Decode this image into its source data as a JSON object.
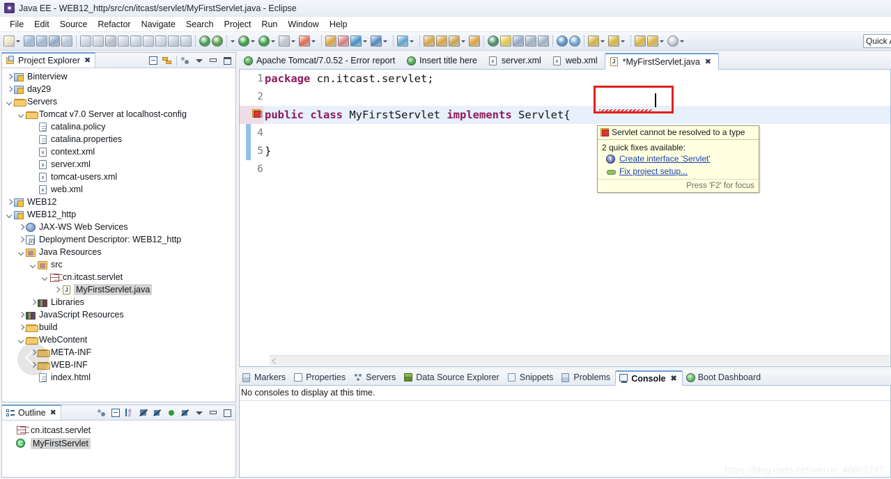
{
  "window": {
    "title": "Java EE - WEB12_http/src/cn/itcast/servlet/MyFirstServlet.java - Eclipse",
    "app_icon": "eclipse-icon"
  },
  "menubar": {
    "items": [
      "File",
      "Edit",
      "Source",
      "Refactor",
      "Navigate",
      "Search",
      "Project",
      "Run",
      "Window",
      "Help"
    ]
  },
  "toolbar": {
    "quick_access_placeholder": "Quick Access",
    "quick_access_value": "Quick A",
    "icons": [
      "new-wizard-icon",
      "new-dropdown-icon",
      "save-icon",
      "save-all-icon",
      "print-icon",
      "quick-fix-icon",
      "resume-icon",
      "suspend-icon",
      "terminate-icon",
      "disconnect-icon",
      "step-into-icon",
      "step-over-icon",
      "step-return-icon",
      "skip-breakpoints-icon",
      "run-last-tool-icon",
      "open-type-icon",
      "debug-icon",
      "debug-dropdown-icon",
      "run-icon",
      "run-dropdown-icon",
      "run-as-icon",
      "run-as-dropdown-icon",
      "stop-icon",
      "stop-dropdown-icon",
      "run-server-icon",
      "run-server-dropdown-icon",
      "new-java-project-icon",
      "new-package-icon",
      "new-class-icon",
      "new-class-dropdown-icon",
      "new-annotation-icon",
      "new-annotation-dropdown-icon",
      "search-icon",
      "search-dropdown-icon",
      "open-resource-icon",
      "open-folder-icon",
      "edit-icon",
      "edit-dropdown-icon",
      "open-perspective-icon",
      "pin-editor-icon",
      "toggle-mark-occurrences-icon",
      "link-icon",
      "show-whitespace-icon",
      "word-wrap-icon",
      "browser-icon",
      "external-tools-icon",
      "download-icon",
      "download-dropdown-icon",
      "upload-icon",
      "upload-dropdown-icon",
      "back-icon",
      "forward-icon",
      "forward-dropdown-icon",
      "next-annotation-icon",
      "next-annotation-dropdown-icon"
    ]
  },
  "project_explorer": {
    "tab_label": "Project Explorer",
    "tab_icon": "project-explorer-icon",
    "close_glyph": "✖",
    "tools": [
      "collapse-all-icon",
      "link-with-editor-icon",
      "view-filter-icon",
      "view-menu-icon",
      "minimize-icon",
      "maximize-icon"
    ],
    "tree": [
      {
        "label": "Binterview",
        "indent": 0,
        "twisty": "closed",
        "icon": "java-project-icon"
      },
      {
        "label": "day29",
        "indent": 0,
        "twisty": "closed",
        "icon": "java-project-icon"
      },
      {
        "label": "Servers",
        "indent": 0,
        "twisty": "open",
        "icon": "folder-open-icon"
      },
      {
        "label": "Tomcat v7.0 Server at localhost-config",
        "indent": 1,
        "twisty": "open",
        "icon": "folder-open-icon"
      },
      {
        "label": "catalina.policy",
        "indent": 2,
        "twisty": "none",
        "icon": "file-icon"
      },
      {
        "label": "catalina.properties",
        "indent": 2,
        "twisty": "none",
        "icon": "file-icon"
      },
      {
        "label": "context.xml",
        "indent": 2,
        "twisty": "none",
        "icon": "xml-file-icon"
      },
      {
        "label": "server.xml",
        "indent": 2,
        "twisty": "none",
        "icon": "xml-file-icon"
      },
      {
        "label": "tomcat-users.xml",
        "indent": 2,
        "twisty": "none",
        "icon": "xml-file-icon"
      },
      {
        "label": "web.xml",
        "indent": 2,
        "twisty": "none",
        "icon": "xml-file-icon"
      },
      {
        "label": "WEB12",
        "indent": 0,
        "twisty": "closed",
        "icon": "web-project-icon"
      },
      {
        "label": "WEB12_http",
        "indent": 0,
        "twisty": "open",
        "icon": "web-project-icon"
      },
      {
        "label": "JAX-WS Web Services",
        "indent": 1,
        "twisty": "closed",
        "icon": "web-service-icon"
      },
      {
        "label": "Deployment Descriptor: WEB12_http",
        "indent": 1,
        "twisty": "closed",
        "icon": "deployment-descriptor-icon"
      },
      {
        "label": "Java Resources",
        "indent": 1,
        "twisty": "open",
        "icon": "java-resources-icon"
      },
      {
        "label": "src",
        "indent": 2,
        "twisty": "open",
        "icon": "source-folder-icon"
      },
      {
        "label": "cn.itcast.servlet",
        "indent": 3,
        "twisty": "open",
        "icon": "package-icon"
      },
      {
        "label": "MyFirstServlet.java",
        "indent": 4,
        "twisty": "closed",
        "icon": "java-file-icon",
        "selected": true
      },
      {
        "label": "Libraries",
        "indent": 2,
        "twisty": "closed",
        "icon": "libraries-icon"
      },
      {
        "label": "JavaScript Resources",
        "indent": 1,
        "twisty": "closed",
        "icon": "libraries-icon"
      },
      {
        "label": "build",
        "indent": 1,
        "twisty": "closed",
        "icon": "folder-open-icon"
      },
      {
        "label": "WebContent",
        "indent": 1,
        "twisty": "open",
        "icon": "folder-open-icon"
      },
      {
        "label": "META-INF",
        "indent": 2,
        "twisty": "closed",
        "icon": "folder-open-icon"
      },
      {
        "label": "WEB-INF",
        "indent": 2,
        "twisty": "closed",
        "icon": "folder-open-icon"
      },
      {
        "label": "index.html",
        "indent": 2,
        "twisty": "none",
        "icon": "file-icon"
      }
    ]
  },
  "outline": {
    "tab_label": "Outline",
    "tab_icon": "outline-icon",
    "close_glyph": "✖",
    "tools": [
      "focus-icon",
      "collapse-all-icon",
      "sort-icon",
      "hide-fields-icon",
      "hide-static-icon",
      "hide-nonpublic-icon",
      "hide-local-icon",
      "view-menu-icon",
      "minimize-icon",
      "maximize-icon"
    ],
    "items": [
      {
        "label": "cn.itcast.servlet",
        "icon": "package-icon",
        "selected": false
      },
      {
        "label": "MyFirstServlet",
        "icon": "class-icon",
        "selected": true
      }
    ]
  },
  "editor": {
    "tabs": [
      {
        "label": "Apache Tomcat/7.0.52 - Error report",
        "icon": "web-browser-icon",
        "active": false,
        "closable": false
      },
      {
        "label": "Insert title here",
        "icon": "web-browser-icon",
        "active": false,
        "closable": false
      },
      {
        "label": "server.xml",
        "icon": "xml-file-icon",
        "active": false,
        "closable": false
      },
      {
        "label": "web.xml",
        "icon": "xml-file-icon",
        "active": false,
        "closable": false
      },
      {
        "label": "*MyFirstServlet.java",
        "icon": "java-file-icon",
        "active": true,
        "closable": true,
        "close_glyph": "✖"
      }
    ],
    "code_lines": [
      {
        "no": "1",
        "tokens": [
          {
            "t": "package",
            "c": "kw"
          },
          {
            "t": " cn.itcast.servlet;",
            "c": "plain"
          }
        ],
        "highlighted": false,
        "error": false
      },
      {
        "no": "2",
        "tokens": [],
        "highlighted": false,
        "error": false
      },
      {
        "no": "3",
        "tokens": [
          {
            "t": "public",
            "c": "kw"
          },
          {
            "t": " ",
            "c": "plain"
          },
          {
            "t": "class",
            "c": "kw"
          },
          {
            "t": " MyFirstServlet ",
            "c": "plain"
          },
          {
            "t": "implements",
            "c": "kw"
          },
          {
            "t": " Servlet{",
            "c": "plain"
          }
        ],
        "highlighted": true,
        "error": true
      },
      {
        "no": "4",
        "tokens": [],
        "highlighted": false,
        "error": false
      },
      {
        "no": "5",
        "tokens": [
          {
            "t": "}",
            "c": "plain"
          }
        ],
        "highlighted": false,
        "error": false
      },
      {
        "no": "6",
        "tokens": [],
        "highlighted": false,
        "error": false
      }
    ],
    "error_annotation_color": "#e02020",
    "hover_popup": {
      "title": "Servlet cannot be resolved to a type",
      "title_icon": "error-marker-icon",
      "subtitle": "2 quick fixes available:",
      "fixes": [
        {
          "label": "Create interface 'Servlet'",
          "icon": "quick-fix-bulb-icon"
        },
        {
          "label": "Fix project setup...",
          "icon": "quick-fix-wrench-icon"
        }
      ],
      "footer": "Press 'F2' for focus"
    }
  },
  "bottom_panel": {
    "tabs": [
      {
        "label": "Markers",
        "icon": "markers-icon",
        "active": false,
        "closable": false
      },
      {
        "label": "Properties",
        "icon": "properties-icon",
        "active": false,
        "closable": false
      },
      {
        "label": "Servers",
        "icon": "servers-icon",
        "active": false,
        "closable": false
      },
      {
        "label": "Data Source Explorer",
        "icon": "data-source-icon",
        "active": false,
        "closable": false
      },
      {
        "label": "Snippets",
        "icon": "snippets-icon",
        "active": false,
        "closable": false
      },
      {
        "label": "Problems",
        "icon": "problems-icon",
        "active": false,
        "closable": false
      },
      {
        "label": "Console",
        "icon": "console-icon",
        "active": true,
        "closable": true,
        "close_glyph": "✖"
      },
      {
        "label": "Boot Dashboard",
        "icon": "boot-dashboard-icon",
        "active": false,
        "closable": false
      }
    ],
    "console_message": "No consoles to display at this time."
  },
  "watermark": {
    "text": "https://blog.csdn.net/weixin_40807247"
  }
}
